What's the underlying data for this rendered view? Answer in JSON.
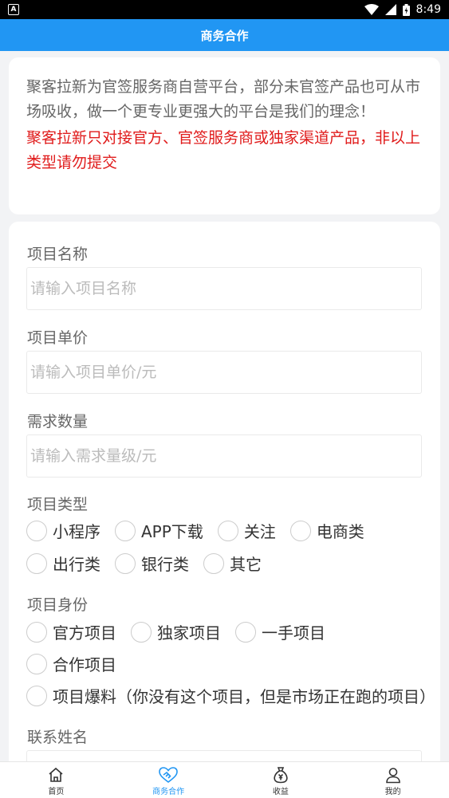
{
  "status_bar": {
    "notification_glyph": "A",
    "time": "8:49"
  },
  "header": {
    "title": "商务合作"
  },
  "intro": {
    "text": "聚客拉新为官签服务商自营平台，部分未官签产品也可从市场吸收，做一个更专业更强大的平台是我们的理念！",
    "warning": "聚客拉新只对接官方、官签服务商或独家渠道产品，非以上类型请勿提交"
  },
  "form": {
    "project_name": {
      "label": "项目名称",
      "placeholder": "请输入项目名称"
    },
    "unit_price": {
      "label": "项目单价",
      "placeholder": "请输入项目单价/元"
    },
    "quantity": {
      "label": "需求数量",
      "placeholder": "请输入需求量级/元"
    },
    "project_type": {
      "label": "项目类型",
      "options": [
        "小程序",
        "APP下载",
        "关注",
        "电商类",
        "出行类",
        "银行类",
        "其它"
      ]
    },
    "project_identity": {
      "label": "项目身份",
      "options": [
        "官方项目",
        "独家项目",
        "一手项目",
        "合作项目",
        "项目爆料（你没有这个项目，但是市场正在跑的项目）"
      ]
    },
    "contact_name": {
      "label": "联系姓名"
    }
  },
  "tabbar": {
    "items": [
      {
        "label": "首页",
        "icon": "home-icon",
        "active": false
      },
      {
        "label": "商务合作",
        "icon": "handshake-icon",
        "active": true
      },
      {
        "label": "收益",
        "icon": "money-bag-icon",
        "active": false
      },
      {
        "label": "我的",
        "icon": "user-icon",
        "active": false
      }
    ]
  },
  "colors": {
    "accent": "#2196f3",
    "warning": "#e01b1b"
  }
}
